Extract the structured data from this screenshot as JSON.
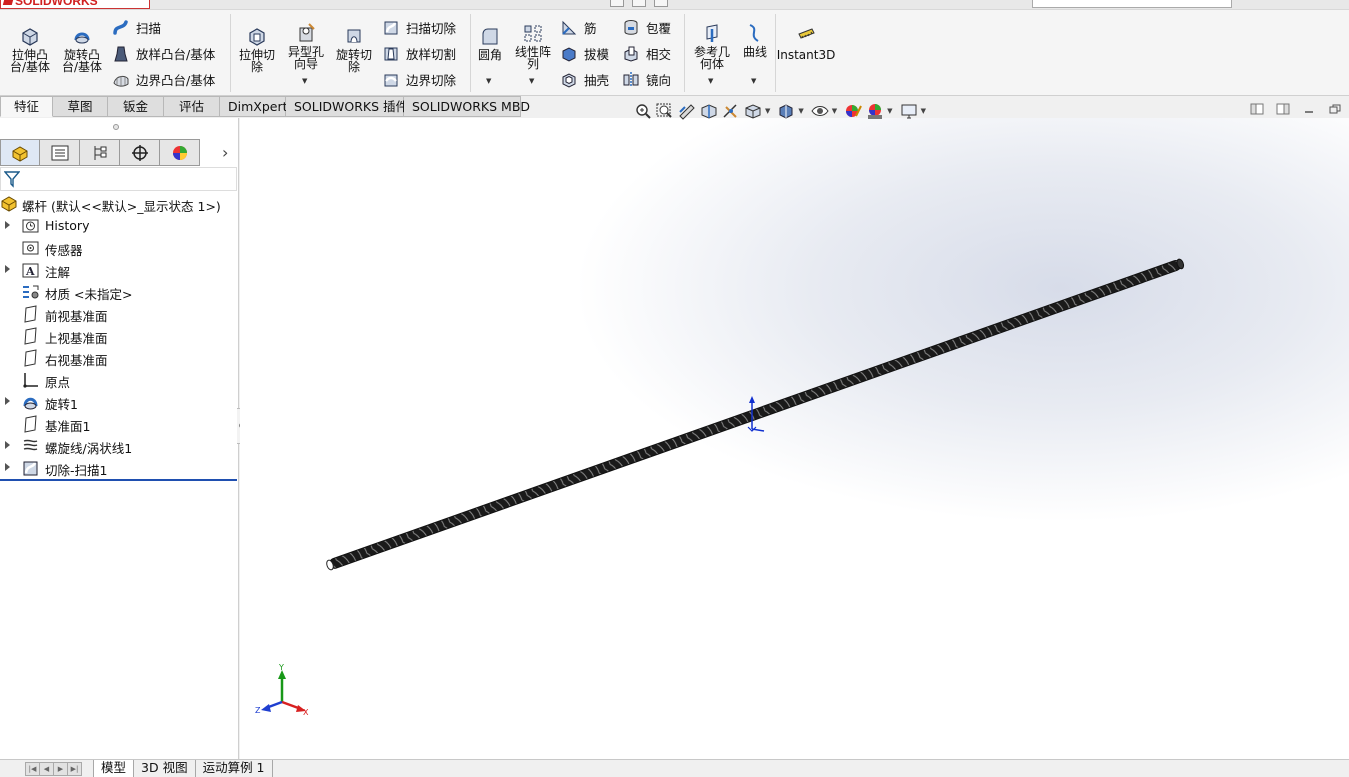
{
  "app": {
    "brand": "SOLIDWORKS"
  },
  "ribbon": {
    "large": [
      {
        "id": "extrude-boss",
        "label": "拉伸凸\n台/基体",
        "icon": "extrude-boss-icon"
      },
      {
        "id": "revolve-boss",
        "label": "旋转凸\n台/基体",
        "icon": "revolve-boss-icon"
      },
      {
        "id": "extrude-cut",
        "label": "拉伸切\n除",
        "icon": "extrude-cut-icon"
      },
      {
        "id": "hole-wizard",
        "label": "异型孔\n向导",
        "icon": "hole-wizard-icon"
      },
      {
        "id": "revolve-cut",
        "label": "旋转切\n除",
        "icon": "revolve-cut-icon"
      },
      {
        "id": "fillet",
        "label": "圆角",
        "icon": "fillet-icon"
      },
      {
        "id": "linear-pattern",
        "label": "线性阵\n列",
        "icon": "linear-pattern-icon"
      },
      {
        "id": "ref-geometry",
        "label": "参考几\n何体",
        "icon": "reference-geometry-icon"
      },
      {
        "id": "curves",
        "label": "曲线",
        "icon": "curves-icon"
      },
      {
        "id": "instant3d",
        "label": "Instant3D",
        "icon": "instant3d-icon"
      }
    ],
    "small": [
      {
        "id": "sweep",
        "label": "扫描",
        "icon": "sweep-icon"
      },
      {
        "id": "loft",
        "label": "放样凸台/基体",
        "icon": "loft-icon"
      },
      {
        "id": "boundary",
        "label": "边界凸台/基体",
        "icon": "boundary-boss-icon"
      },
      {
        "id": "swept-cut",
        "label": "扫描切除",
        "icon": "swept-cut-icon"
      },
      {
        "id": "lofted-cut",
        "label": "放样切割",
        "icon": "lofted-cut-icon"
      },
      {
        "id": "boundary-cut",
        "label": "边界切除",
        "icon": "boundary-cut-icon"
      },
      {
        "id": "rib",
        "label": "筋",
        "icon": "rib-icon"
      },
      {
        "id": "draft",
        "label": "拔模",
        "icon": "draft-icon"
      },
      {
        "id": "shell",
        "label": "抽壳",
        "icon": "shell-icon"
      },
      {
        "id": "wrap",
        "label": "包覆",
        "icon": "wrap-icon"
      },
      {
        "id": "intersect",
        "label": "相交",
        "icon": "intersect-icon"
      },
      {
        "id": "mirror",
        "label": "镜向",
        "icon": "mirror-icon"
      }
    ]
  },
  "tabs": [
    "特征",
    "草图",
    "钣金",
    "评估",
    "DimXpert",
    "SOLIDWORKS 插件",
    "SOLIDWORKS MBD"
  ],
  "tree": {
    "root": "螺杆 (默认<<默认>_显示状态 1>)",
    "items": [
      {
        "label": "History",
        "icon": "history-folder-icon",
        "expandable": true
      },
      {
        "label": "传感器",
        "icon": "sensors-icon",
        "expandable": false
      },
      {
        "label": "注解",
        "icon": "annotations-icon",
        "expandable": true
      },
      {
        "label": "材质 <未指定>",
        "icon": "material-icon",
        "expandable": false
      },
      {
        "label": "前视基准面",
        "icon": "plane-icon",
        "expandable": false
      },
      {
        "label": "上视基准面",
        "icon": "plane-icon",
        "expandable": false
      },
      {
        "label": "右视基准面",
        "icon": "plane-icon",
        "expandable": false
      },
      {
        "label": "原点",
        "icon": "origin-icon",
        "expandable": false
      },
      {
        "label": "旋转1",
        "icon": "revolve-feature-icon",
        "expandable": true
      },
      {
        "label": "基准面1",
        "icon": "plane-icon",
        "expandable": false
      },
      {
        "label": "螺旋线/涡状线1",
        "icon": "helix-icon",
        "expandable": true
      },
      {
        "label": "切除-扫描1",
        "icon": "cut-sweep-icon",
        "expandable": true
      }
    ]
  },
  "triad": {
    "y": "Y",
    "x": "X",
    "z": "Z"
  },
  "bottom_tabs": [
    "模型",
    "3D 视图",
    "运动算例 1"
  ],
  "colors": {
    "accent": "#1f4fb0",
    "rollback": "#1f4fb0",
    "model": "#1a1a1a"
  }
}
